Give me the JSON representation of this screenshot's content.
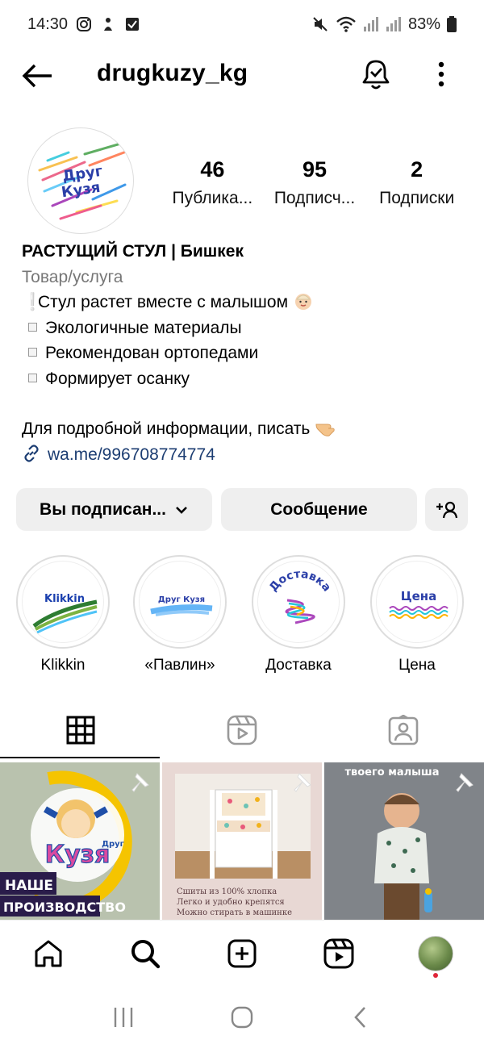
{
  "status_bar": {
    "time": "14:30",
    "battery": "83%"
  },
  "header": {
    "username": "drugkuzy_kg"
  },
  "profile": {
    "avatar_text": [
      "Друг",
      "Кузя"
    ],
    "stats": [
      {
        "value": "46",
        "label": "Публика..."
      },
      {
        "value": "95",
        "label": "Подписч..."
      },
      {
        "value": "2",
        "label": "Подписки"
      }
    ]
  },
  "bio": {
    "name": "РАСТУЩИЙ СТУЛ | Бишкек",
    "category": "Товар/услуга",
    "lines": [
      "Стул растет вместе с малышом",
      "Экологичные материалы",
      "Рекомендован ортопедами",
      "Формирует осанку"
    ],
    "contact_line": "Для подробной информации, писать",
    "link": "wa.me/996708774774"
  },
  "buttons": {
    "follow_label": "Вы подписан...",
    "message_label": "Сообщение"
  },
  "highlights": [
    {
      "label": "Klikkin",
      "cover_text": "Klikkin"
    },
    {
      "label": "«Павлин»",
      "cover_text": "Друг Кузя"
    },
    {
      "label": "Доставка",
      "cover_text": "Доставка"
    },
    {
      "label": "Цена",
      "cover_text": "Цена"
    }
  ],
  "posts": [
    {
      "caption_top": "",
      "overlay_lines": [
        "НАШЕ",
        "ПРОИЗВОДСТВО"
      ],
      "logo": [
        "Друг",
        "Кузя"
      ]
    },
    {
      "caption_top": "",
      "overlay_lines": [
        "Сшиты из 100% хлопка",
        "Легко и удобно крепятся",
        "Можно стирать в машинке"
      ]
    },
    {
      "caption_top": "твоего малыша",
      "overlay_lines": []
    }
  ],
  "colors": {
    "button_bg": "#efefef",
    "link": "#1c3d72",
    "notification_dot": "#e0263a"
  },
  "icons": [
    "back-arrow-icon",
    "bell-check-icon",
    "more-vertical-icon",
    "link-icon",
    "chevron-down-icon",
    "add-person-icon",
    "grid-icon",
    "reels-icon",
    "tagged-icon",
    "pin-icon",
    "home-icon",
    "search-icon",
    "create-icon",
    "reels-nav-icon",
    "recents-icon",
    "home-circle-icon",
    "back-chevron-icon"
  ]
}
